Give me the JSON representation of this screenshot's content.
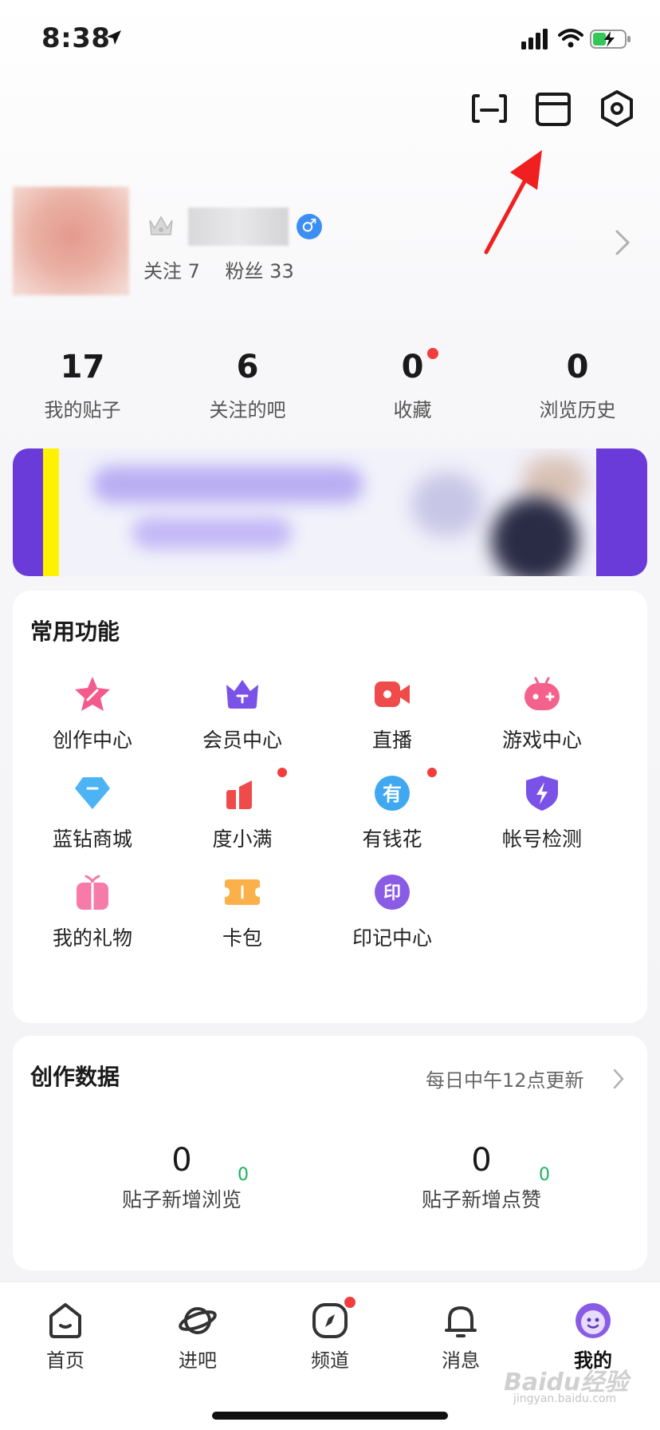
{
  "status_bar": {
    "time": "8:38"
  },
  "profile": {
    "following_label": "关注 7",
    "fans_label": "粉丝 33",
    "gender_symbol": "♂"
  },
  "stats": [
    {
      "value": "17",
      "label": "我的贴子"
    },
    {
      "value": "6",
      "label": "关注的吧"
    },
    {
      "value": "0",
      "label": "收藏"
    },
    {
      "value": "0",
      "label": "浏览历史"
    }
  ],
  "features": {
    "title": "常用功能",
    "items": [
      {
        "label": "创作中心",
        "icon": "star-pen-icon",
        "color": "#f45b8c"
      },
      {
        "label": "会员中心",
        "icon": "crown-icon",
        "color": "#7a52e8"
      },
      {
        "label": "直播",
        "icon": "video-camera-icon",
        "color": "#f04b4b"
      },
      {
        "label": "游戏中心",
        "icon": "gamepad-icon",
        "color": "#f4618c"
      },
      {
        "label": "蓝钻商城",
        "icon": "diamond-icon",
        "color": "#4cb3f5"
      },
      {
        "label": "度小满",
        "icon": "bar-chart-icon",
        "color": "#f04b4b"
      },
      {
        "label": "有钱花",
        "icon": "money-icon",
        "color": "#3fa8f0"
      },
      {
        "label": "帐号检测",
        "icon": "shield-bolt-icon",
        "color": "#7a52e8"
      },
      {
        "label": "我的礼物",
        "icon": "gift-icon",
        "color": "#f67ba6"
      },
      {
        "label": "卡包",
        "icon": "ticket-icon",
        "color": "#fbb04a"
      },
      {
        "label": "印记中心",
        "icon": "seal-icon",
        "color": "#8a5ce6",
        "glyph": "印"
      }
    ]
  },
  "creation": {
    "title": "创作数据",
    "subtitle": "每日中午12点更新",
    "metrics": [
      {
        "value": "0",
        "label": "贴子新增浏览",
        "delta": "0"
      },
      {
        "value": "0",
        "label": "贴子新增点赞",
        "delta": "0"
      }
    ]
  },
  "tabs": [
    {
      "label": "首页",
      "icon": "home-icon"
    },
    {
      "label": "进吧",
      "icon": "planet-icon"
    },
    {
      "label": "频道",
      "icon": "compass-icon"
    },
    {
      "label": "消息",
      "icon": "bell-icon"
    },
    {
      "label": "我的",
      "icon": "smiley-avatar-icon",
      "active": true
    }
  ],
  "watermark": {
    "text": "Baidu经验",
    "sub": "jingyan.baidu.com"
  }
}
